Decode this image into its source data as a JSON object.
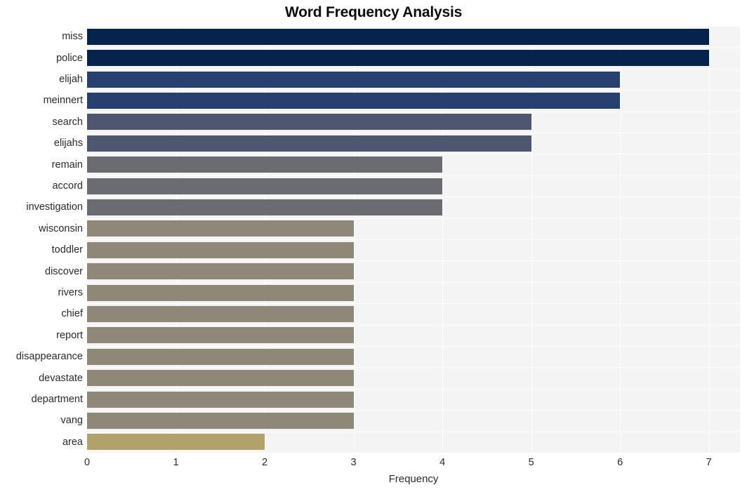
{
  "chart_data": {
    "type": "bar",
    "orientation": "horizontal",
    "title": "Word Frequency Analysis",
    "xlabel": "Frequency",
    "ylabel": "",
    "xlim": [
      0,
      7.35
    ],
    "xticks": [
      0,
      1,
      2,
      3,
      4,
      5,
      6,
      7
    ],
    "xtick_labels": [
      "0",
      "1",
      "2",
      "3",
      "4",
      "5",
      "6",
      "7"
    ],
    "grid": true,
    "grid_color": "#fdfdfd",
    "plot_background": "#f4f4f5",
    "legend": null,
    "categories": [
      "miss",
      "police",
      "elijah",
      "meinnert",
      "search",
      "elijahs",
      "remain",
      "accord",
      "investigation",
      "wisconsin",
      "toddler",
      "discover",
      "rivers",
      "chief",
      "report",
      "disappearance",
      "devastate",
      "department",
      "vang",
      "area"
    ],
    "values": [
      7,
      7,
      6,
      6,
      5,
      5,
      4,
      4,
      4,
      3,
      3,
      3,
      3,
      3,
      3,
      3,
      3,
      3,
      3,
      2
    ],
    "bar_colors": [
      "#05234c",
      "#05234c",
      "#27406f",
      "#27406f",
      "#4f5670",
      "#4f5670",
      "#6b6c71",
      "#6b6c71",
      "#6b6c71",
      "#8f8878",
      "#8f8878",
      "#8f8878",
      "#8f8878",
      "#8f8878",
      "#8f8878",
      "#8f8878",
      "#8f8878",
      "#8f8878",
      "#8f8878",
      "#b0a26a"
    ]
  }
}
